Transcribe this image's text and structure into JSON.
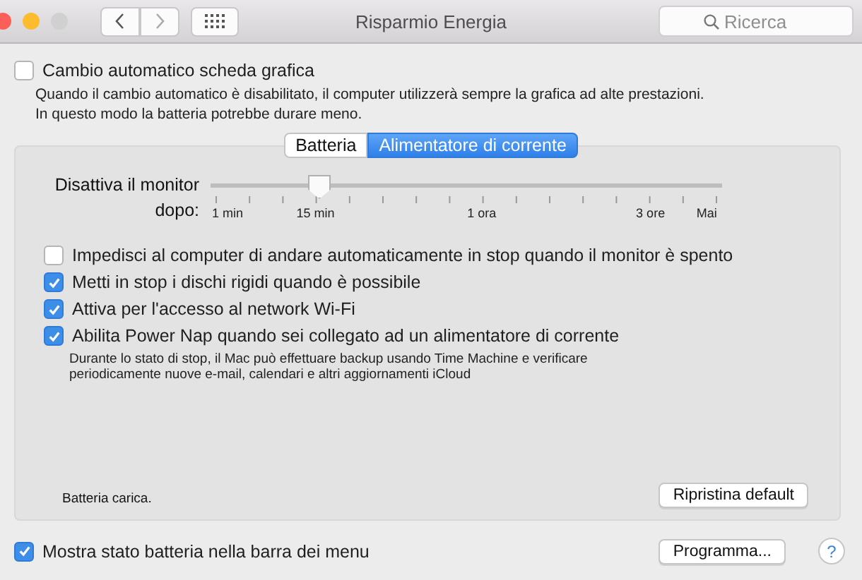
{
  "window": {
    "title": "Risparmio Energia"
  },
  "search": {
    "placeholder": "Ricerca"
  },
  "graphics_switch": {
    "label": "Cambio automatico scheda grafica",
    "checked": false,
    "description": "Quando il cambio automatico è disabilitato, il computer utilizzerà sempre la grafica ad alte prestazioni.\nIn questo modo la batteria potrebbe durare meno."
  },
  "tabs": [
    {
      "label": "Batteria",
      "selected": false
    },
    {
      "label": "Alimentatore di corrente",
      "selected": true
    }
  ],
  "display_sleep": {
    "label": "Disattiva il monitor dopo:",
    "level": 0.21,
    "tick_labels": [
      "1 min",
      "15 min",
      "1 ora",
      "3 ore",
      "Mai"
    ]
  },
  "options": [
    {
      "label": "Impedisci al computer di andare automaticamente in stop quando il monitor è spento",
      "checked": false
    },
    {
      "label": "Metti in stop i dischi rigidi quando è possibile",
      "checked": true
    },
    {
      "label": "Attiva per l'accesso al network Wi-Fi",
      "checked": true
    },
    {
      "label": "Abilita Power Nap quando sei collegato ad un alimentatore di corrente",
      "checked": true,
      "description": "Durante lo stato di stop, il Mac può effettuare backup usando Time Machine e verificare\nperiodicamente nuove e-mail, calendari e altri aggiornamenti iCloud"
    }
  ],
  "status": "Batteria carica.",
  "restore_button": "Ripristina default",
  "menu_bar_option": {
    "label": "Mostra stato batteria nella barra dei menu",
    "checked": true
  },
  "schedule_button": "Programma...",
  "help_button": "?"
}
